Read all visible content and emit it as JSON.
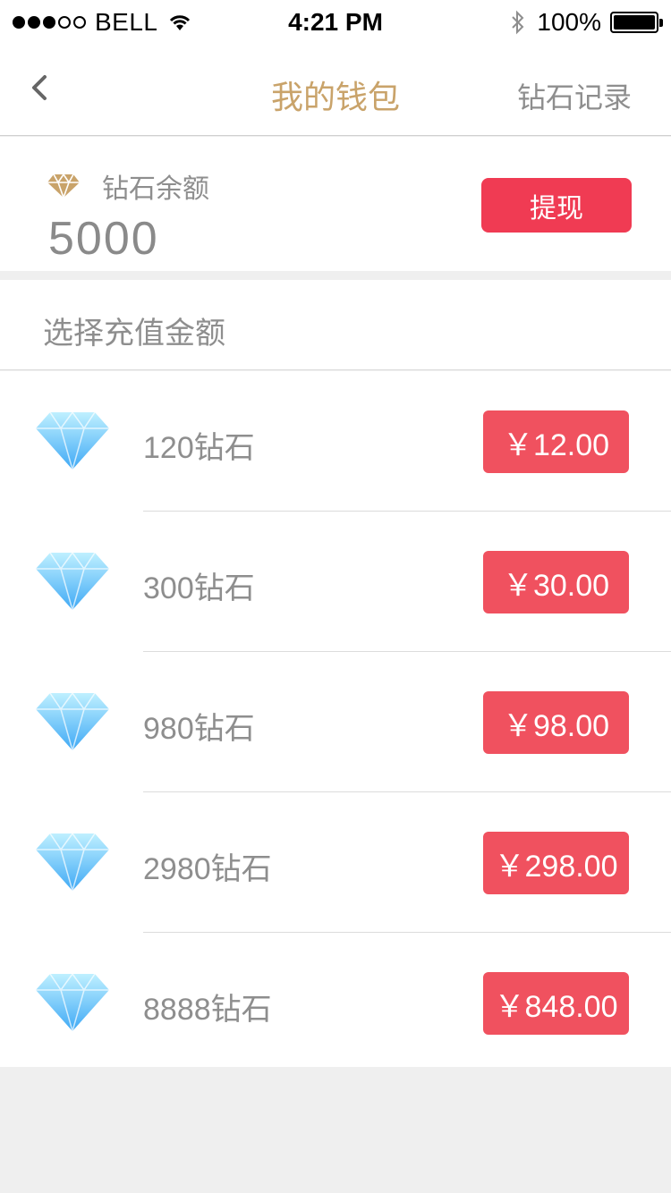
{
  "status_bar": {
    "carrier": "BELL",
    "time": "4:21 PM",
    "battery": "100%"
  },
  "nav": {
    "title": "我的钱包",
    "right_label": "钻石记录"
  },
  "balance": {
    "label": "钻石余额",
    "value": "5000",
    "withdraw_label": "提现"
  },
  "recharge": {
    "title": "选择充值金额",
    "packages": [
      {
        "label": "120钻石",
        "price": "￥12.00"
      },
      {
        "label": "300钻石",
        "price": "￥30.00"
      },
      {
        "label": "980钻石",
        "price": "￥98.00"
      },
      {
        "label": "2980钻石",
        "price": "￥298.00"
      },
      {
        "label": "8888钻石",
        "price": "￥848.00"
      }
    ]
  },
  "colors": {
    "accent_gold": "#c9a36a",
    "withdraw_red": "#f03b53",
    "price_red": "#f0515f",
    "background": "#efefef"
  }
}
